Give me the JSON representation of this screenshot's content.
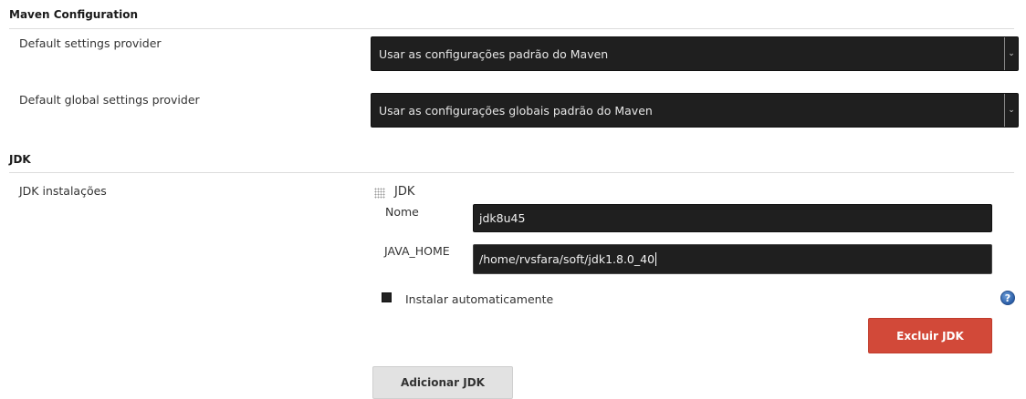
{
  "maven": {
    "title": "Maven Configuration",
    "default_settings": {
      "label": "Default settings provider",
      "value": "Usar as configurações padrão do Maven"
    },
    "global_settings": {
      "label": "Default global settings provider",
      "value": "Usar as configurações globais padrão do Maven"
    }
  },
  "jdk": {
    "title": "JDK",
    "installations_label": "JDK instalações",
    "block_title": "JDK",
    "name_label": "Nome",
    "name_value": "jdk8u45",
    "java_home_label": "JAVA_HOME",
    "java_home_value": "/home/rvsfara/soft/jdk1.8.0_40",
    "auto_install_label": "Instalar automaticamente",
    "auto_install_checked": true,
    "delete_button": "Excluir JDK",
    "add_button": "Adicionar JDK"
  },
  "icons": {
    "select_arrow": "chevron-down-icon",
    "help": "help-icon",
    "drag_handle": "drag-handle-icon"
  },
  "colors": {
    "danger_button": "#d24939",
    "input_background": "#1f1f1f",
    "help_icon": "#2b5ea8"
  }
}
